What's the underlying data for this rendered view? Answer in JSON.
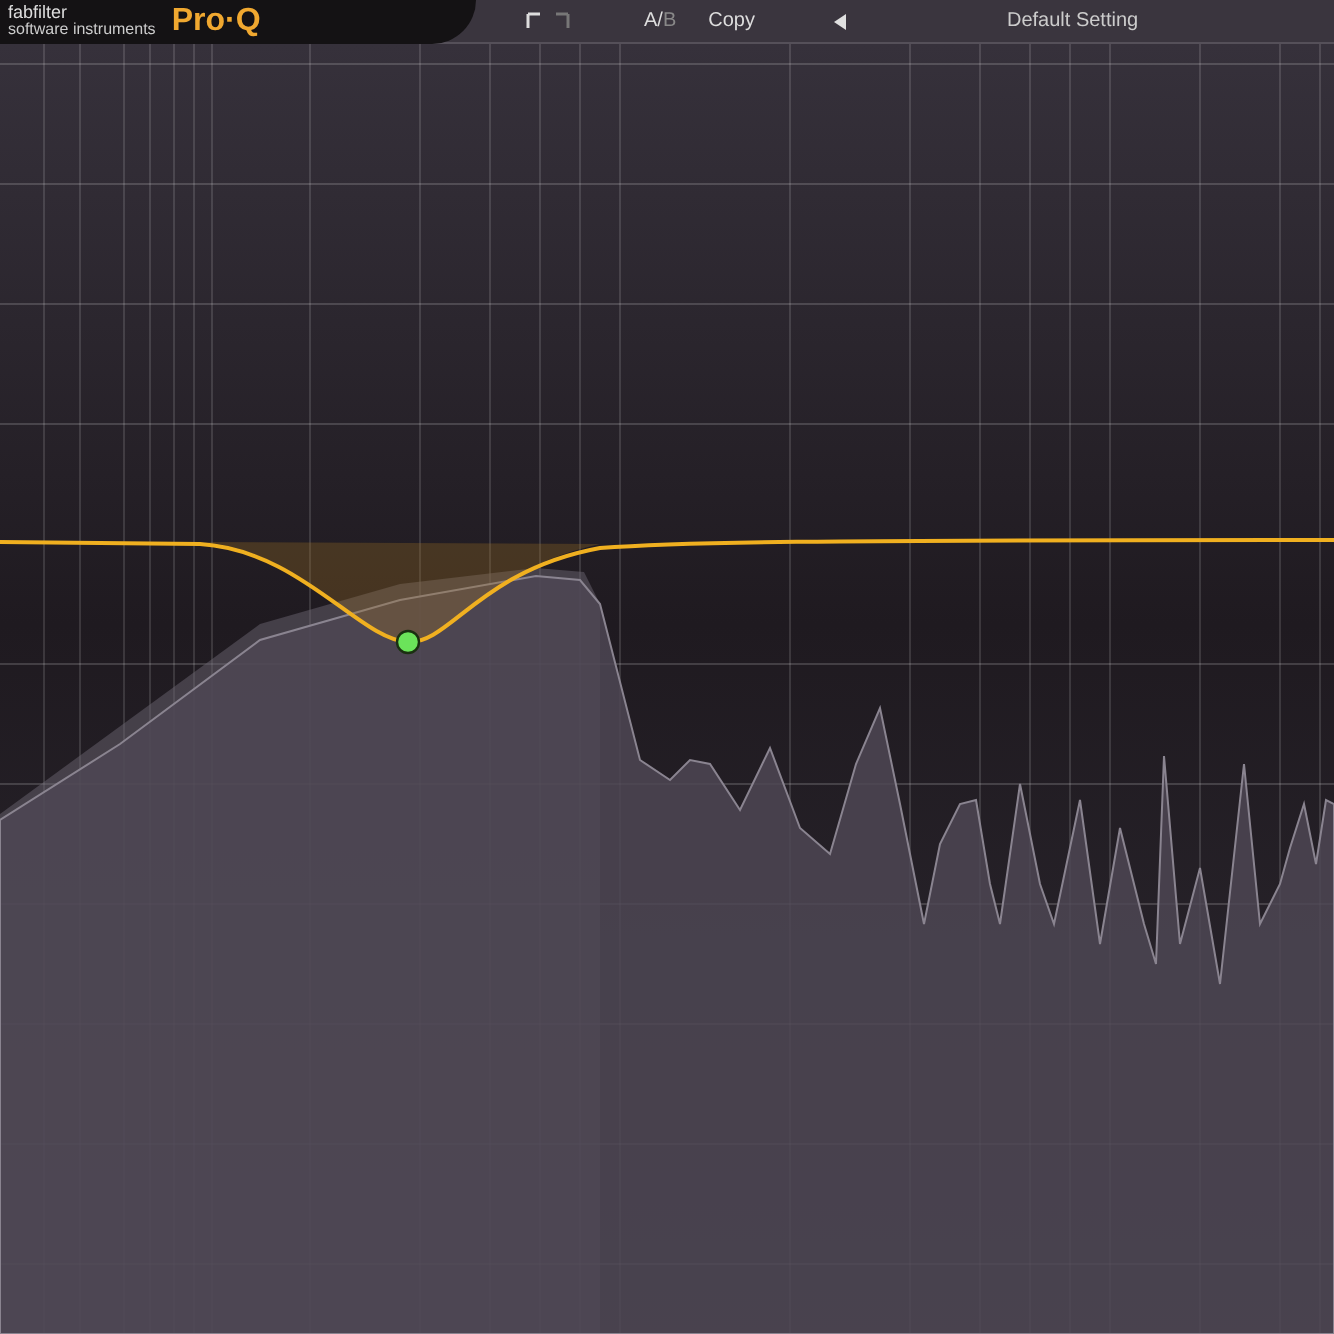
{
  "header": {
    "brand": "fabfilter",
    "tagline": "software instruments",
    "product": "Pro·Q",
    "ab": {
      "a": "A",
      "separator": "/",
      "b": "B"
    },
    "copy": "Copy",
    "preset": "Default Setting"
  },
  "bands": [
    {
      "selected": true,
      "color": "#6be35a"
    }
  ]
}
